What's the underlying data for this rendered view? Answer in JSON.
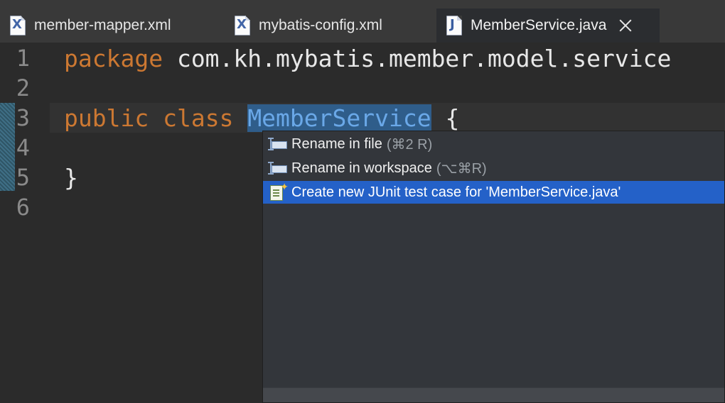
{
  "tabs": [
    {
      "label": "member-mapper.xml",
      "icon": "xml-file-icon",
      "glyph": "X"
    },
    {
      "label": "mybatis-config.xml",
      "icon": "xml-file-icon",
      "glyph": "X"
    },
    {
      "label": "MemberService.java",
      "icon": "java-file-icon",
      "glyph": "J",
      "active": true
    }
  ],
  "editor": {
    "lines": [
      {
        "number": "1",
        "t1": "package",
        "t2": " com.kh.mybatis.member.model.service"
      },
      {
        "number": "2"
      },
      {
        "number": "3",
        "t1": "public",
        "t2": " ",
        "t3": "class",
        "t4": " ",
        "t5": "MemberService",
        "t6": " {"
      },
      {
        "number": "4"
      },
      {
        "number": "5",
        "t1": "}"
      },
      {
        "number": "6"
      }
    ]
  },
  "popup": {
    "items": [
      {
        "label": "Rename in file",
        "shortcut": "(⌘2 R)",
        "icon": "rename-icon"
      },
      {
        "label": "Rename in workspace",
        "shortcut": "(⌥⌘R)",
        "icon": "rename-icon"
      },
      {
        "label": "Create new JUnit test case for 'MemberService.java'",
        "icon": "junit-new-icon",
        "selected": true
      }
    ]
  },
  "colors": {
    "keyword": "#cc7832",
    "selection": "#2f5d8a",
    "popup_selected": "#2461c8"
  }
}
